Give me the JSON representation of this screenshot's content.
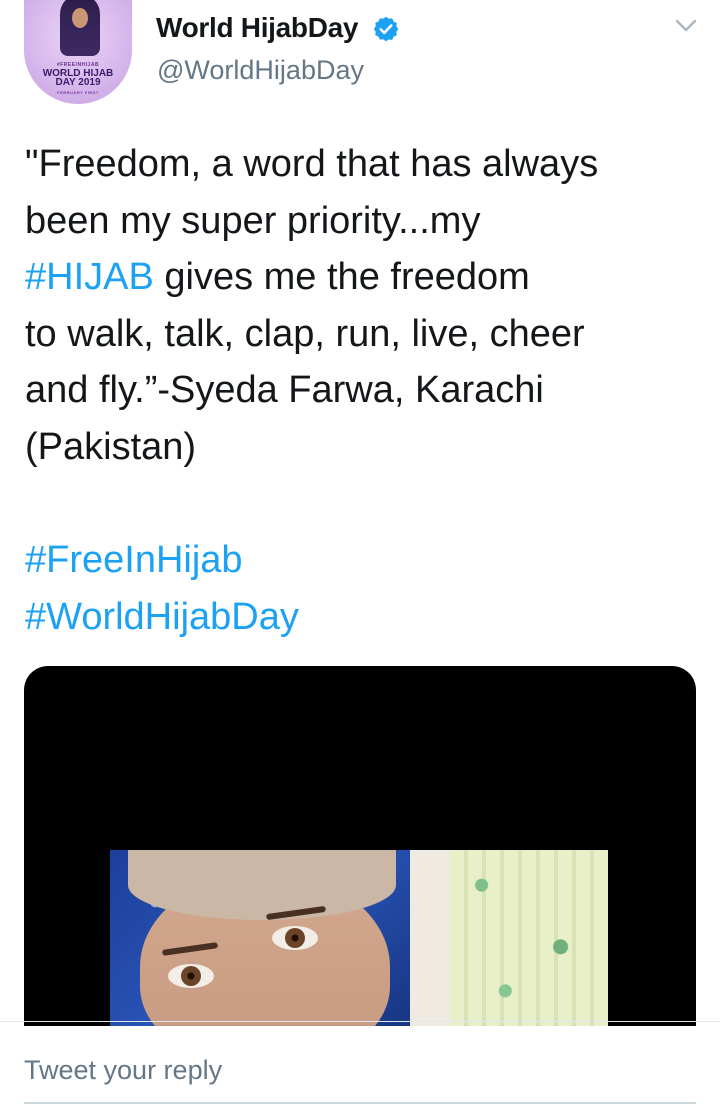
{
  "account": {
    "display_name": "World HijabDay",
    "handle": "@WorldHijabDay",
    "verified": true,
    "avatar": {
      "tag": "#FREEINHIJAB",
      "brand_line1": "WORLD HIJAB",
      "brand_line2": "DAY 2019",
      "sub": "FEBRUARY FIRST"
    }
  },
  "tweet": {
    "lines": [
      [
        {
          "text": "\"Freedom, a word that has always",
          "hashtag": false
        }
      ],
      [
        {
          "text": "been my super priority...my",
          "hashtag": false
        }
      ],
      [
        {
          "text": "#HIJAB",
          "hashtag": true
        },
        {
          "text": " gives me the freedom",
          "hashtag": false
        }
      ],
      [
        {
          "text": "to walk, talk, clap, run, live, cheer",
          "hashtag": false
        }
      ],
      [
        {
          "text": "and fly.”-Syeda Farwa, Karachi",
          "hashtag": false
        }
      ],
      [
        {
          "text": "(Pakistan)",
          "hashtag": false
        }
      ],
      [
        {
          "text": "",
          "hashtag": false
        }
      ],
      [
        {
          "text": "#FreeInHijab",
          "hashtag": true
        }
      ],
      [
        {
          "text": "#WorldHijabDay",
          "hashtag": true
        }
      ]
    ]
  },
  "media": {
    "type": "photo"
  },
  "reply": {
    "placeholder": "Tweet your reply",
    "value": ""
  },
  "icons": {
    "verified": "verified-badge-icon",
    "more": "chevron-down-icon"
  },
  "colors": {
    "hashtag": "#1da1f2",
    "text": "#14171a",
    "secondary": "#657786",
    "verified": "#1da1f2"
  }
}
